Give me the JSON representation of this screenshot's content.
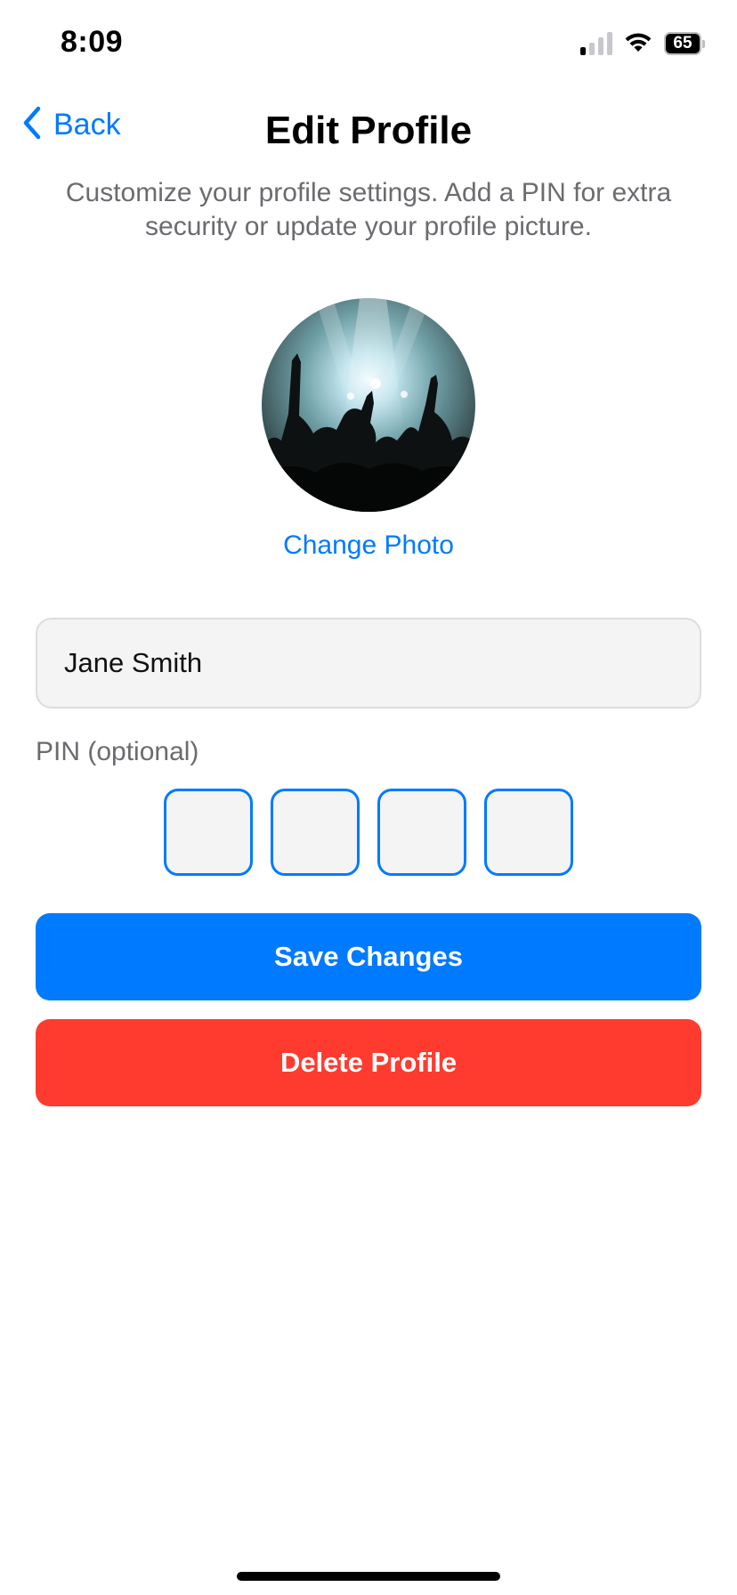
{
  "status_bar": {
    "time": "8:09",
    "battery_level": "65",
    "signal_bars_active": 1,
    "signal_bars_total": 4
  },
  "header": {
    "back_label": "Back",
    "title": "Edit Profile",
    "subtitle": "Customize your profile settings. Add a PIN for extra security or update your profile picture."
  },
  "profile": {
    "change_photo_label": "Change Photo",
    "name_value": "Jane Smith"
  },
  "pin": {
    "label": "PIN (optional)",
    "digits": [
      "",
      "",
      "",
      ""
    ]
  },
  "actions": {
    "save_label": "Save Changes",
    "delete_label": "Delete Profile"
  },
  "colors": {
    "accent": "#007aff",
    "danger": "#ff3b30",
    "secondary_text": "#6b6b70",
    "field_background": "#f4f4f5"
  }
}
